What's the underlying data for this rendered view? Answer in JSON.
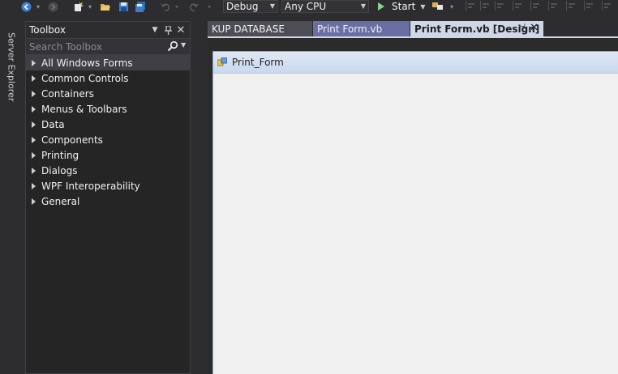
{
  "toolbar": {
    "config_value": "Debug",
    "platform_value": "Any CPU",
    "start_label": "Start"
  },
  "server_explorer": {
    "label": "Server Explorer"
  },
  "toolbox": {
    "title": "Toolbox",
    "search_placeholder": "Search Toolbox",
    "groups": [
      {
        "label": "All Windows Forms"
      },
      {
        "label": "Common Controls"
      },
      {
        "label": "Containers"
      },
      {
        "label": "Menus & Toolbars"
      },
      {
        "label": "Data"
      },
      {
        "label": "Components"
      },
      {
        "label": "Printing"
      },
      {
        "label": "Dialogs"
      },
      {
        "label": "WPF Interoperability"
      },
      {
        "label": "General"
      }
    ]
  },
  "tabs": [
    {
      "label": "KUP DATABASE"
    },
    {
      "label": "Print Form.vb"
    },
    {
      "label": "Print Form.vb [Design]"
    }
  ],
  "designer": {
    "form_title": "Print_Form"
  },
  "colors": {
    "background": "#2d2d30",
    "toolbox_bg": "#252526",
    "active_tab": "#cfd6e5",
    "form_bg": "#f0f0f0"
  }
}
